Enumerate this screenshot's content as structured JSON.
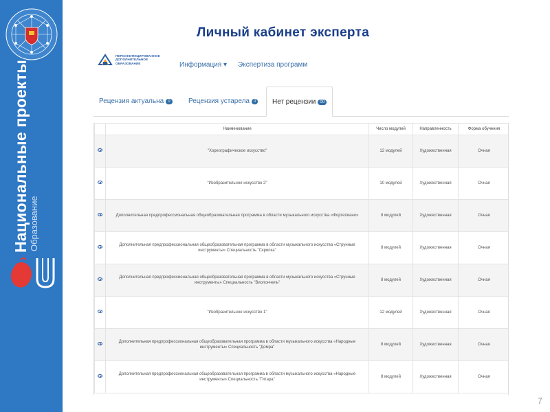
{
  "slide": {
    "title": "Личный кабинет эксперта",
    "page_number": "7"
  },
  "sidebar": {
    "vertical_title": "Национальные проекты",
    "vertical_subtitle": "Образование"
  },
  "header": {
    "brand_lines": [
      "ПЕРСОНИФИЦИРОВАННОЕ",
      "ДОПОЛНИТЕЛЬНОЕ",
      "ОБРАЗОВАНИЕ"
    ],
    "nav": [
      {
        "label": "Информация ▾"
      },
      {
        "label": "Экспертиза программ"
      }
    ]
  },
  "tabs": [
    {
      "label": "Рецензия актуальна",
      "badge": "0",
      "active": false
    },
    {
      "label": "Рецензия устарела",
      "badge": "0",
      "active": false
    },
    {
      "label": "Нет рецензии",
      "badge": "00",
      "active": true
    }
  ],
  "table": {
    "columns": [
      "",
      "Наименование",
      "Число модулей",
      "Направленность",
      "Форма обучения"
    ],
    "rows": [
      {
        "name": "\"Хореографическое искусство\"",
        "modules": "12 модулей",
        "direction": "Художественная",
        "form": "Очная"
      },
      {
        "name": "\"Изобразительное искусство 2\"",
        "modules": "10 модулей",
        "direction": "Художественная",
        "form": "Очная"
      },
      {
        "name": "Дополнительная предпрофессиональная общеобразовательная программа в области музыкального искусства «Фортепиано»",
        "modules": "8 модулей",
        "direction": "Художественная",
        "form": "Очная"
      },
      {
        "name": "Дополнительная предпрофессиональная общеобразовательная программа в области музыкального искусства «Струнные инструменты» Специальность \"Скрипка\"",
        "modules": "8 модулей",
        "direction": "Художественная",
        "form": "Очная"
      },
      {
        "name": "Дополнительная предпрофессиональная общеобразовательная программа в области музыкального искусства «Струнные инструменты» Специальность \"Виолончель\"",
        "modules": "8 модулей",
        "direction": "Художественная",
        "form": "Очная"
      },
      {
        "name": "\"Изобразительное искусство 1\"",
        "modules": "12 модулей",
        "direction": "Художественная",
        "form": "Очная"
      },
      {
        "name": "Дополнительная предпрофессиональная общеобразовательная программа в области музыкального искусства «Народные инструменты» Специальность \"Домра\"",
        "modules": "8 модулей",
        "direction": "Художественная",
        "form": "Очная"
      },
      {
        "name": "Дополнительная предпрофессиональная общеобразовательная программа в области музыкального искусства «Народные инструменты» Специальность \"Гитара\"",
        "modules": "8 модулей",
        "direction": "Художественная",
        "form": "Очная"
      }
    ]
  },
  "colors": {
    "sidebar_blue": "#2f78c4",
    "title_blue": "#1a3f8a",
    "link_blue": "#3a6ea8",
    "badge_blue": "#2e6da4"
  }
}
